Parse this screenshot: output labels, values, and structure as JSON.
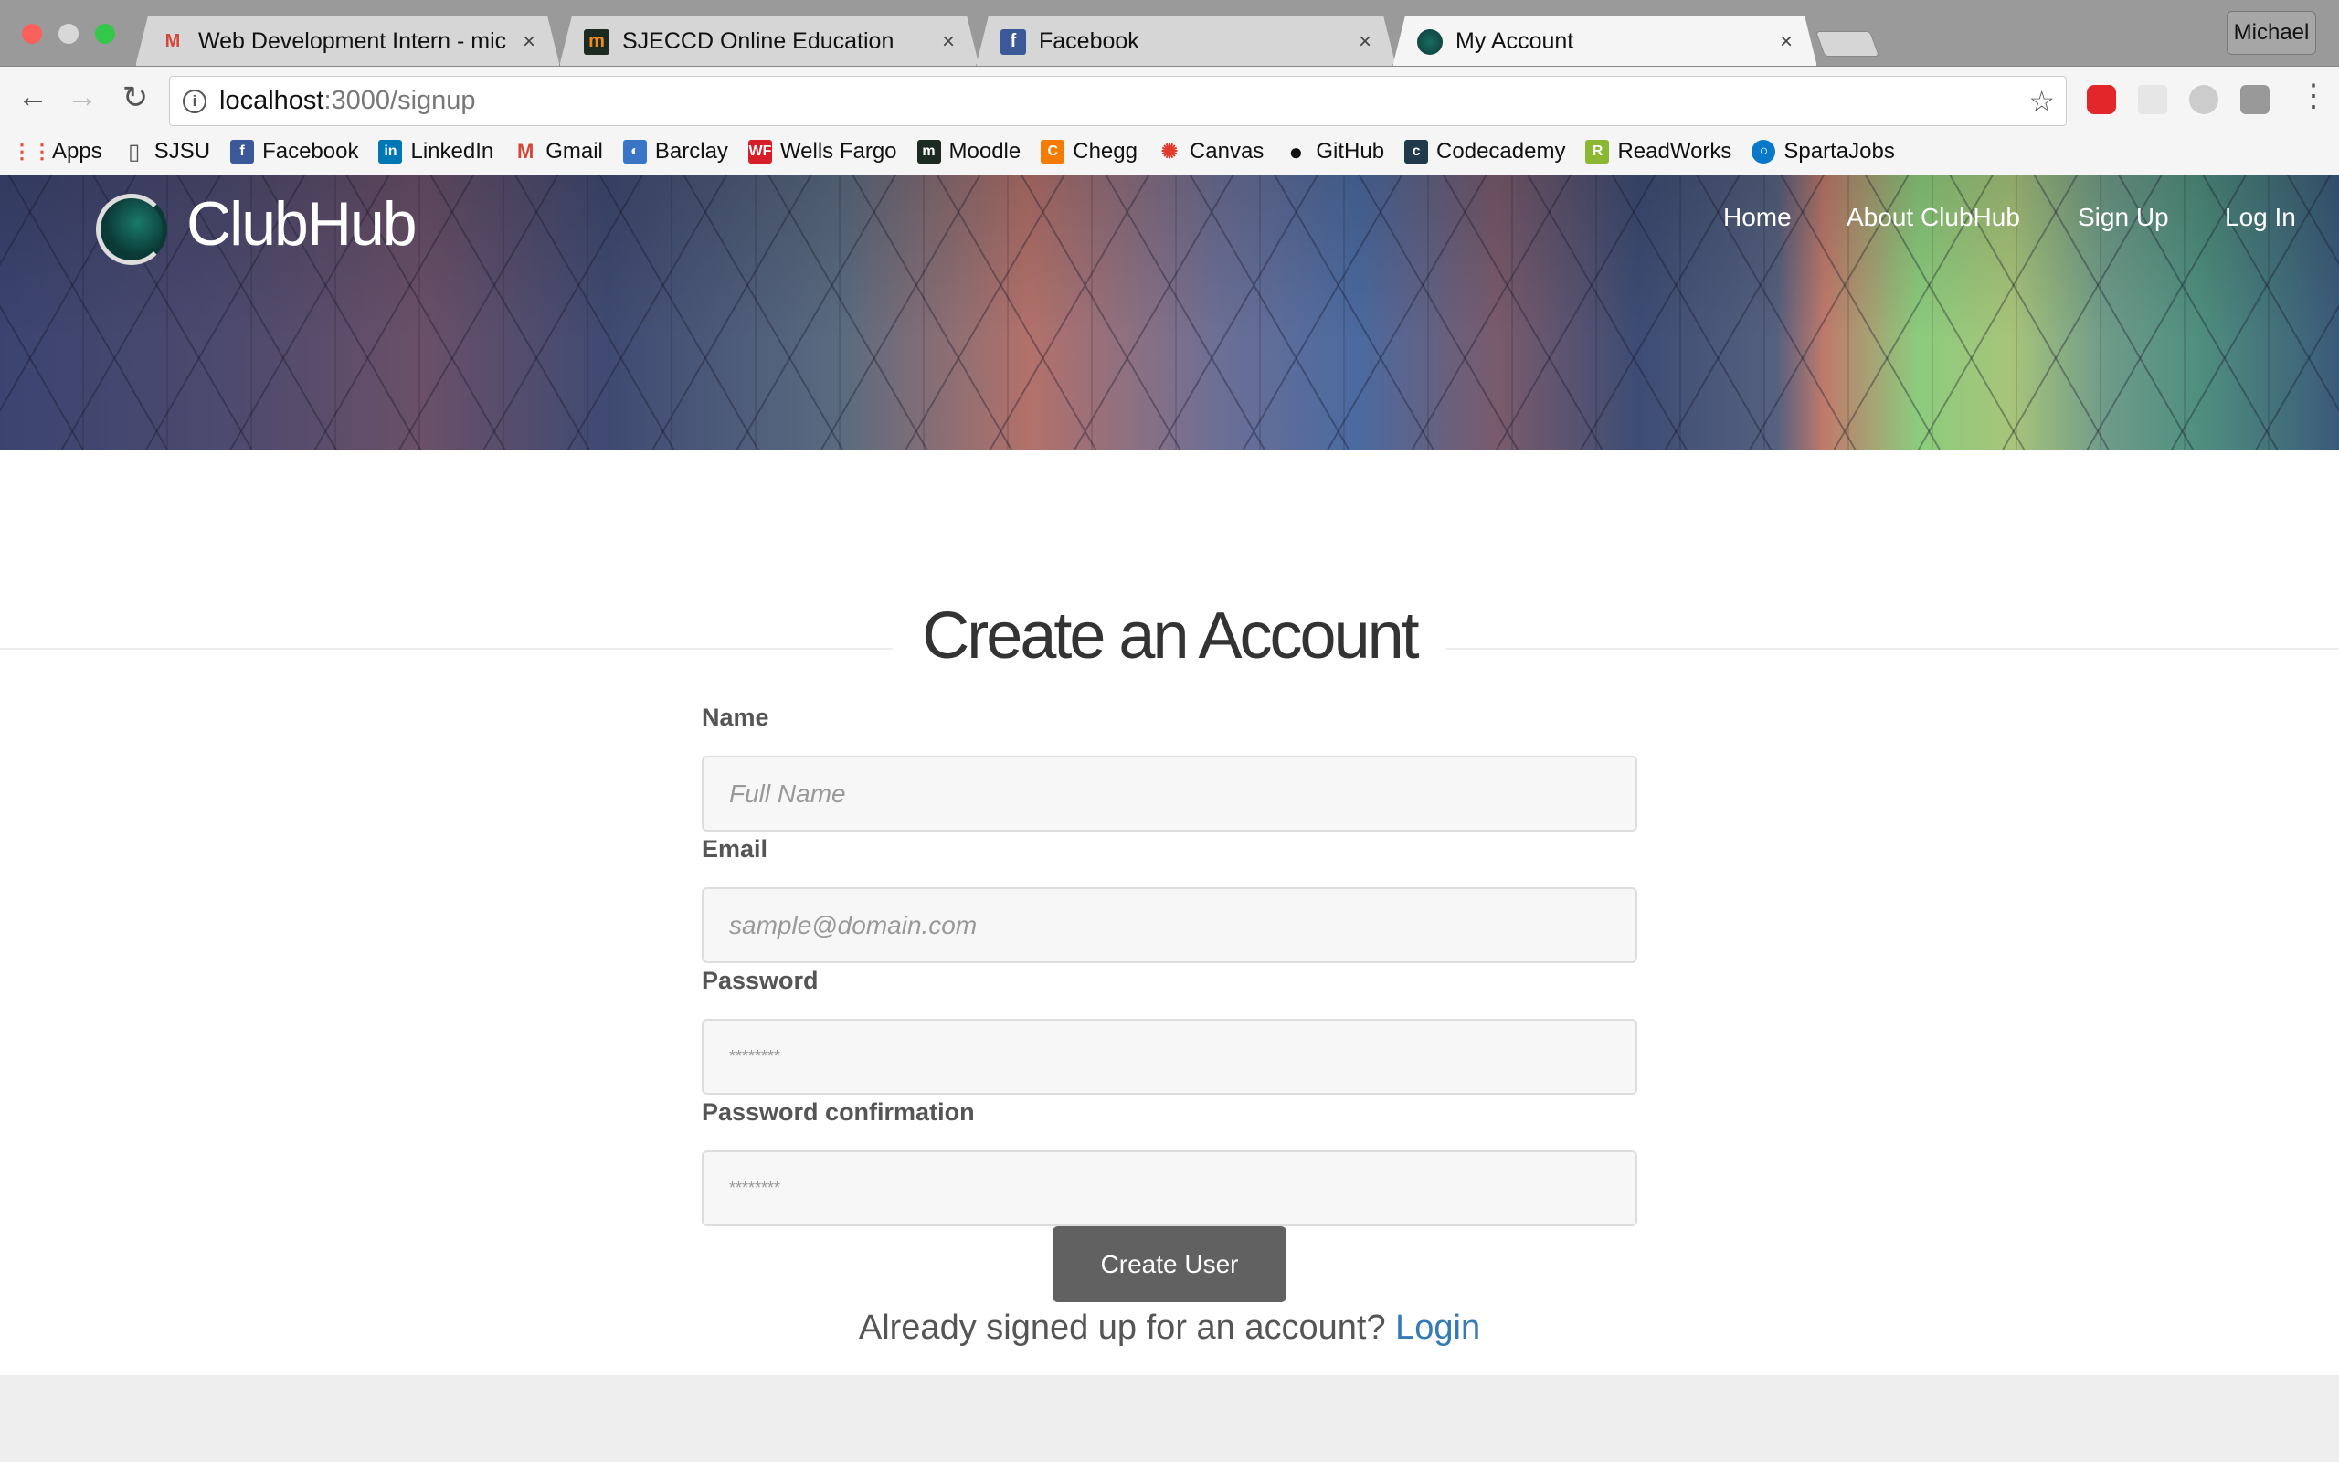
{
  "browser": {
    "tabs": [
      {
        "title": "Web Development Intern - mic",
        "icon": "gmail-icon",
        "active": false
      },
      {
        "title": "SJECCD Online Education",
        "icon": "moodle-icon",
        "active": false
      },
      {
        "title": "Facebook",
        "icon": "facebook-icon",
        "active": false
      },
      {
        "title": "My Account",
        "icon": "clubhub-icon",
        "active": true
      }
    ],
    "close_glyph": "×",
    "profile": "Michael",
    "url_host": "localhost",
    "url_path": ":3000/signup",
    "bookmarks": [
      {
        "label": "Apps",
        "icon": "apps-grid-icon",
        "color": "#e84a3c"
      },
      {
        "label": "SJSU",
        "icon": "page-icon",
        "color": "#ffffff"
      },
      {
        "label": "Facebook",
        "icon": "facebook-icon",
        "color": "#3b5998"
      },
      {
        "label": "LinkedIn",
        "icon": "linkedin-icon",
        "color": "#0077b5"
      },
      {
        "label": "Gmail",
        "icon": "gmail-icon",
        "color": "#d44638"
      },
      {
        "label": "Barclay",
        "icon": "barclay-icon",
        "color": "#3a74c4"
      },
      {
        "label": "Wells Fargo",
        "icon": "wells-fargo-icon",
        "color": "#d71e28"
      },
      {
        "label": "Moodle",
        "icon": "moodle-icon",
        "color": "#1d2a22"
      },
      {
        "label": "Chegg",
        "icon": "chegg-icon",
        "color": "#f57c00"
      },
      {
        "label": "Canvas",
        "icon": "canvas-icon",
        "color": "#e23b2e"
      },
      {
        "label": "GitHub",
        "icon": "github-icon",
        "color": "#111111"
      },
      {
        "label": "Codecademy",
        "icon": "codecademy-icon",
        "color": "#203a4c"
      },
      {
        "label": "ReadWorks",
        "icon": "readworks-icon",
        "color": "#8bb833"
      },
      {
        "label": "SpartaJobs",
        "icon": "spartajobs-icon",
        "color": "#0a78c8"
      }
    ]
  },
  "site": {
    "brand": "ClubHub",
    "nav": [
      "Home",
      "About ClubHub",
      "Sign Up",
      "Log In"
    ]
  },
  "form": {
    "title": "Create an Account",
    "fields": [
      {
        "label": "Name",
        "placeholder": "Full Name",
        "value": ""
      },
      {
        "label": "Email",
        "placeholder": "sample@domain.com",
        "value": ""
      },
      {
        "label": "Password",
        "placeholder": "********",
        "value": ""
      },
      {
        "label": "Password confirmation",
        "placeholder": "********",
        "value": ""
      }
    ],
    "submit": "Create User",
    "already_text": "Already signed up for an account? ",
    "login_link": "Login"
  }
}
